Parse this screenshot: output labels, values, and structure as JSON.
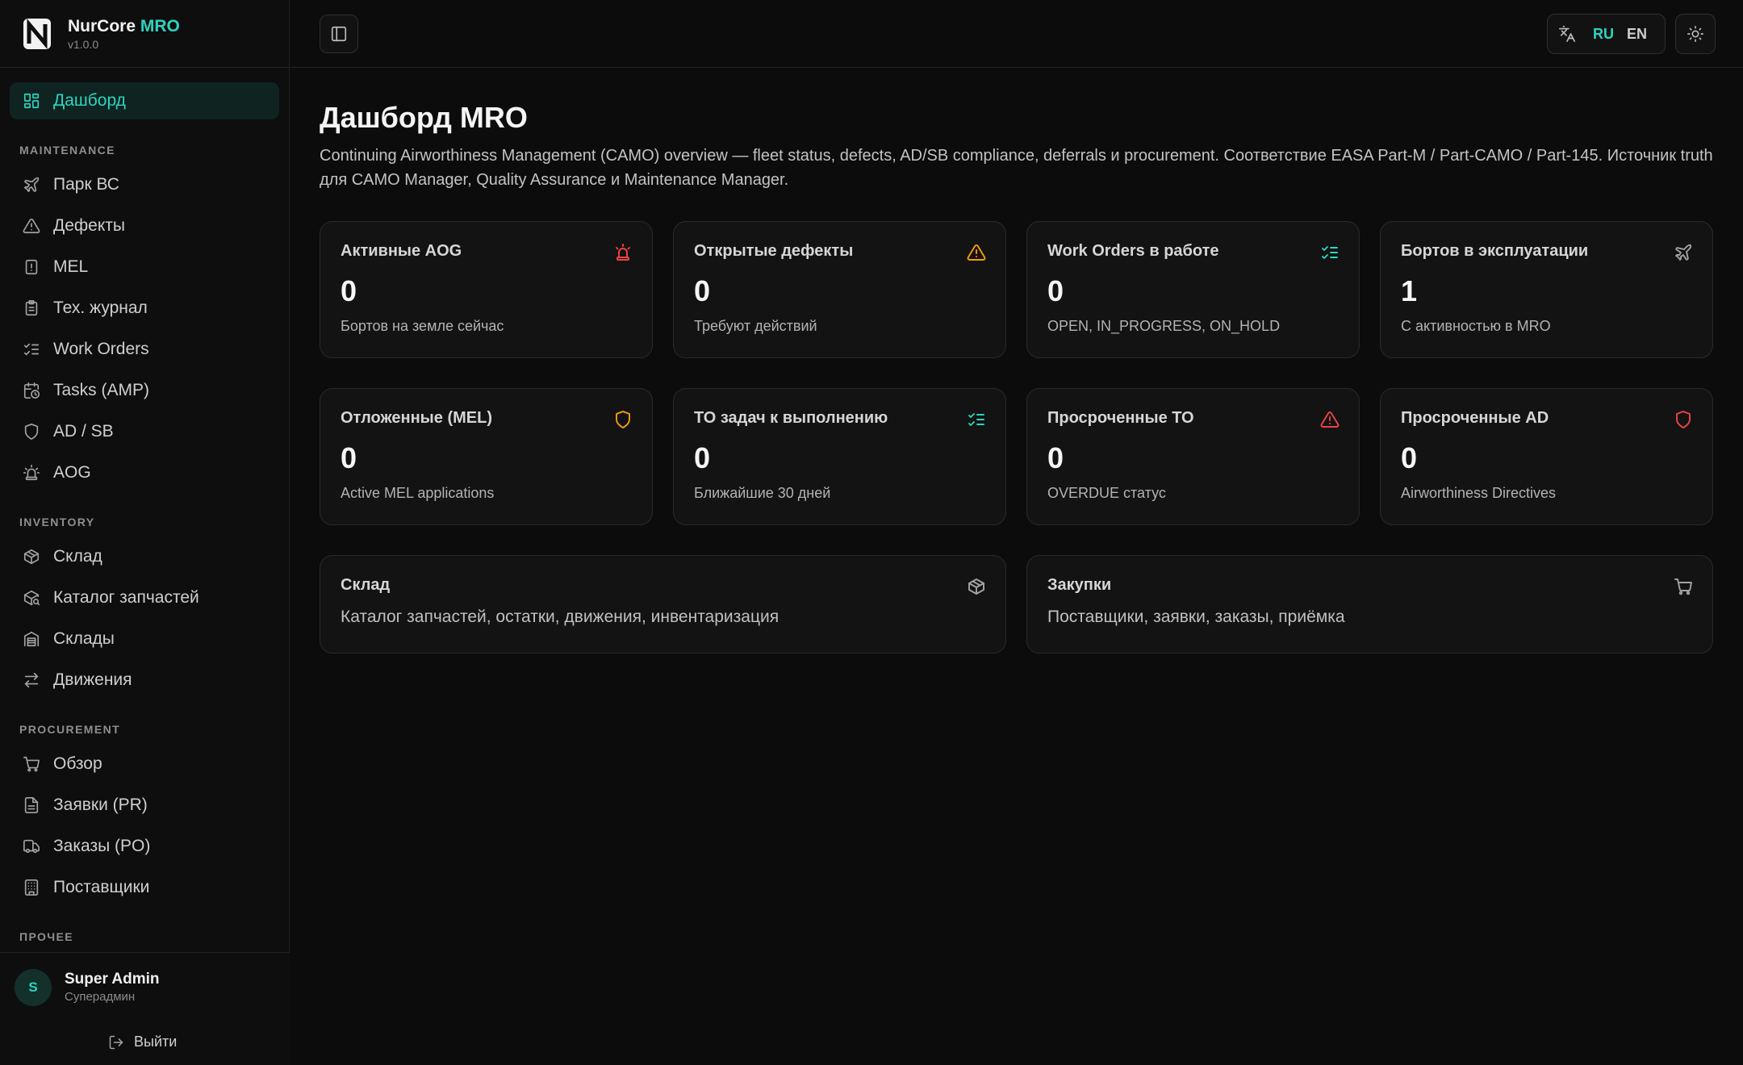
{
  "brand": {
    "name": "NurCore",
    "accent": "MRO",
    "version": "v1.0.0"
  },
  "nav": {
    "dashboard": "Дашборд",
    "sections": {
      "maintenance": "MAINTENANCE",
      "inventory": "INVENTORY",
      "procurement": "PROCUREMENT",
      "other": "ПРОЧЕЕ"
    },
    "maintenance": [
      "Парк ВС",
      "Дефекты",
      "MEL",
      "Тех. журнал",
      "Work Orders",
      "Tasks (AMP)",
      "AD / SB",
      "AOG"
    ],
    "inventory": [
      "Склад",
      "Каталог запчастей",
      "Склады",
      "Движения"
    ],
    "procurement": [
      "Обзор",
      "Заявки (PR)",
      "Заказы (PO)",
      "Поставщики"
    ]
  },
  "user": {
    "initial": "S",
    "name": "Super Admin",
    "role": "Суперадмин",
    "logout": "Выйти"
  },
  "topbar": {
    "lang_ru": "RU",
    "lang_en": "EN",
    "active_lang": "RU"
  },
  "page": {
    "title": "Дашборд MRO",
    "description": "Continuing Airworthiness Management (CAMO) overview — fleet status, defects, AD/SB compliance, deferrals и procurement. Соответствие EASA Part-M / Part-CAMO / Part-145. Источник truth для CAMO Manager, Quality Assurance и Maintenance Manager."
  },
  "stats_row1": [
    {
      "title": "Активные AOG",
      "value": "0",
      "sub": "Бортов на земле сейчас",
      "icon": "siren-icon",
      "color": "#ef4444"
    },
    {
      "title": "Открытые дефекты",
      "value": "0",
      "sub": "Требуют действий",
      "icon": "warning-triangle-icon",
      "color": "#f59e0b"
    },
    {
      "title": "Work Orders в работе",
      "value": "0",
      "sub": "OPEN, IN_PROGRESS, ON_HOLD",
      "icon": "list-checks-icon",
      "color": "#2dd4bf"
    },
    {
      "title": "Бортов в эксплуатации",
      "value": "1",
      "sub": "С активностью в MRO",
      "icon": "plane-icon",
      "color": "#a3a3a3"
    }
  ],
  "stats_row2": [
    {
      "title": "Отложенные (MEL)",
      "value": "0",
      "sub": "Active MEL applications",
      "icon": "shield-icon",
      "color": "#f59e0b"
    },
    {
      "title": "ТО задач к выполнению",
      "value": "0",
      "sub": "Ближайшие 30 дней",
      "icon": "list-checks-icon",
      "color": "#2dd4bf"
    },
    {
      "title": "Просроченные ТО",
      "value": "0",
      "sub": "OVERDUE статус",
      "icon": "warning-triangle-icon",
      "color": "#ef4444"
    },
    {
      "title": "Просроченные AD",
      "value": "0",
      "sub": "Airworthiness Directives",
      "icon": "shield-icon",
      "color": "#ef4444"
    }
  ],
  "modules": [
    {
      "title": "Склад",
      "sub": "Каталог запчастей, остатки, движения, инвентаризация",
      "icon": "package-icon"
    },
    {
      "title": "Закупки",
      "sub": "Поставщики, заявки, заказы, приёмка",
      "icon": "cart-icon"
    }
  ]
}
